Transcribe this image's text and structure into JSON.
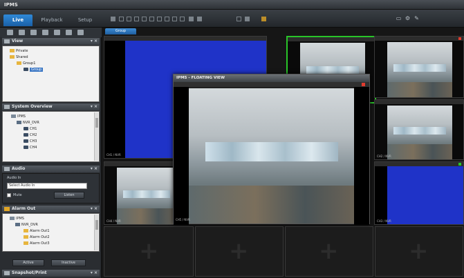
{
  "app": {
    "title": "IPMS"
  },
  "tabs": [
    {
      "label": "Live",
      "active": true
    },
    {
      "label": "Playback",
      "active": false
    },
    {
      "label": "Setup",
      "active": false
    }
  ],
  "view_tab": "Group",
  "panels": {
    "view": {
      "title": "View",
      "items": [
        {
          "label": "Private",
          "icon": "folder-icon"
        },
        {
          "label": "Shared",
          "icon": "folder-icon"
        },
        {
          "label": "Group1",
          "icon": "folder-icon"
        },
        {
          "label": "Group",
          "icon": "grid-icon",
          "selected": true
        }
      ]
    },
    "system_overview": {
      "title": "System Overview",
      "items": [
        {
          "label": "IPMS",
          "icon": "server-icon"
        },
        {
          "label": "NVR_DVR",
          "icon": "dvr-icon"
        },
        {
          "label": "CH1",
          "icon": "camera-icon"
        },
        {
          "label": "CH2",
          "icon": "camera-icon"
        },
        {
          "label": "CH3",
          "icon": "camera-icon"
        },
        {
          "label": "CH4",
          "icon": "camera-icon"
        }
      ]
    },
    "audio": {
      "title": "Audio",
      "group_label": "Audio In",
      "select_value": "Select Audio In",
      "mute_label": "Mute",
      "apply_label": "Listen"
    },
    "alarm_out": {
      "title": "Alarm Out",
      "items": [
        {
          "label": "IPMS",
          "icon": "server-icon"
        },
        {
          "label": "NVR_DVR",
          "icon": "dvr-icon"
        },
        {
          "label": "Alarm Out1",
          "icon": "alarm-icon"
        },
        {
          "label": "Alarm Out2",
          "icon": "alarm-icon"
        },
        {
          "label": "Alarm Out3",
          "icon": "alarm-icon"
        }
      ],
      "button_on": "Active",
      "button_off": "Inactive"
    },
    "snapshot": {
      "title": "Snapshot/Print"
    }
  },
  "floating_view": {
    "title": "IPMS - FLOATING VIEW"
  },
  "cameras": [
    {
      "label": "CH1 / NVR"
    },
    {
      "label": "CH2 / NVR"
    },
    {
      "label": "CH3 / NVR"
    },
    {
      "label": "CH4 / NVR"
    },
    {
      "label": "CH5 / NVR"
    },
    {
      "label": "CH6 / NVR"
    }
  ],
  "colors": {
    "accent": "#2f8ad9",
    "highlight_border": "#29c529",
    "no_video": "#1f33c8"
  }
}
